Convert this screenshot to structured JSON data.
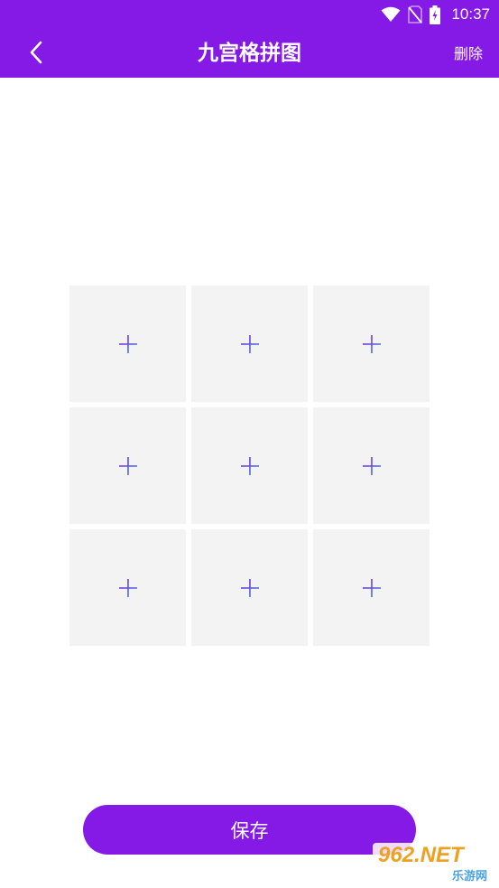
{
  "status_bar": {
    "time": "10:37",
    "icons": [
      "wifi-icon",
      "no-sim-icon",
      "battery-charging-icon"
    ]
  },
  "app_bar": {
    "back_icon": "chevron-left-icon",
    "title": "九宫格拼图",
    "delete_label": "删除"
  },
  "grid": {
    "rows": 3,
    "columns": 3,
    "cell_icon": "plus-icon"
  },
  "save_label": "保存",
  "watermark": {
    "line1": "962.NET",
    "line2": "乐游网"
  },
  "colors": {
    "accent": "#8519E6",
    "cell_background": "#f3f3f3",
    "plus_left": "#8519E6",
    "plus_right": "#3c8fd8"
  }
}
